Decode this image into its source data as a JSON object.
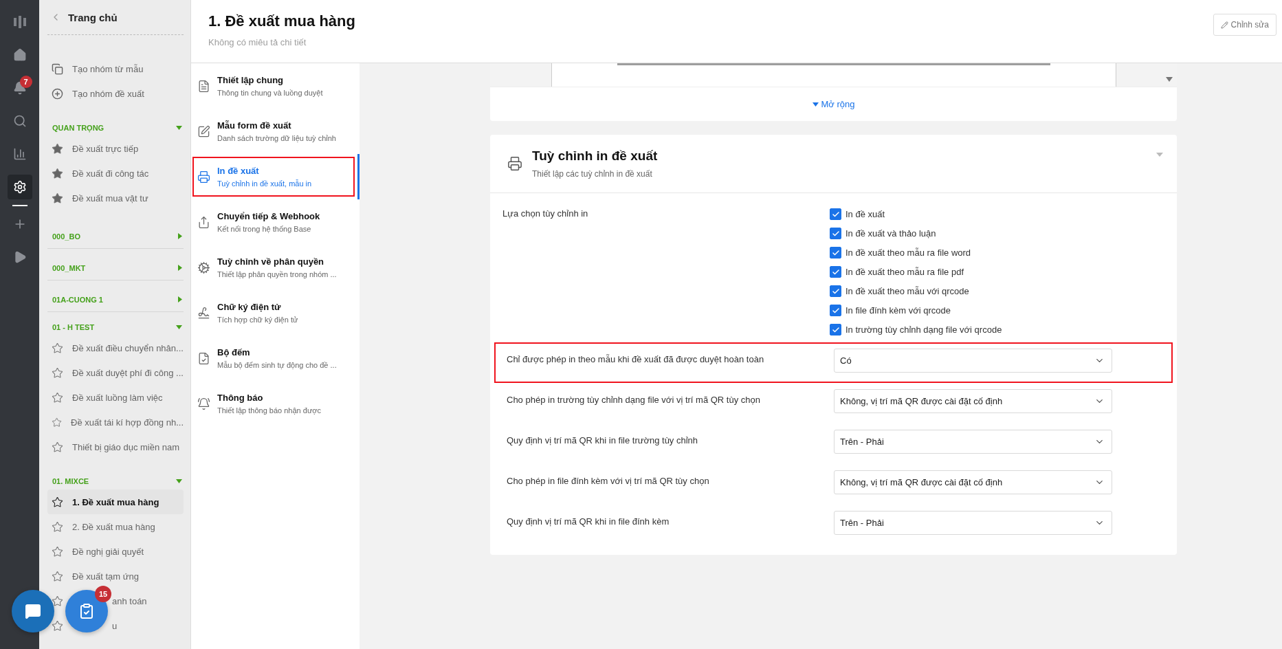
{
  "rail": [
    {
      "kind": "logo",
      "selected": false
    },
    {
      "kind": "home",
      "selected": false
    },
    {
      "kind": "bell",
      "selected": false,
      "badge": "7"
    },
    {
      "kind": "search",
      "selected": false
    },
    {
      "kind": "chart",
      "selected": false
    },
    {
      "kind": "settings",
      "selected": true
    },
    {
      "kind": "add",
      "selected": false
    },
    {
      "kind": "play",
      "selected": false
    }
  ],
  "sidebar": {
    "back_label": "Trang chủ",
    "actions": [
      {
        "kind": "template",
        "label": "Tạo nhóm từ mẫu"
      },
      {
        "kind": "add",
        "label": "Tạo nhóm đề xuất"
      }
    ],
    "groups": [
      {
        "name": "QUAN TRỌNG",
        "expanded": true,
        "items": [
          {
            "kind": "normal",
            "label": "Đề xuất trực tiếp",
            "starred": true,
            "selected": false
          },
          {
            "kind": "normal",
            "label": "Đề xuất đi công tác",
            "starred": true,
            "selected": false
          },
          {
            "kind": "normal",
            "label": "Đề xuất mua vật tư",
            "starred": true,
            "selected": false
          }
        ]
      },
      {
        "name": "000_BO",
        "expanded": false
      },
      {
        "name": "000_MKT",
        "expanded": false
      },
      {
        "name": "01A-CUONG 1",
        "expanded": false
      },
      {
        "name": "01 - H TEST",
        "expanded": true,
        "items": [
          {
            "kind": "normal",
            "label": "Đề xuất điều chuyển nhân...",
            "starred": false,
            "selected": false
          },
          {
            "kind": "normal",
            "label": "Đề xuất duyệt phí đi công ...",
            "starred": false,
            "selected": false
          },
          {
            "kind": "normal",
            "label": "Đề xuất luồng làm việc",
            "starred": false,
            "selected": false
          },
          {
            "kind": "normal",
            "label": "Đề xuất tái kí hợp đồng nh...",
            "starred": false,
            "selected": false
          },
          {
            "kind": "normal",
            "label": "Thiết bị giáo dục miền nam",
            "starred": false,
            "selected": false
          }
        ]
      },
      {
        "name": "01. MIXCE",
        "expanded": true,
        "items": [
          {
            "kind": "normal",
            "label": "1. Đề xuất mua hàng",
            "starred": false,
            "selected": true
          },
          {
            "kind": "normal",
            "label": "2. Đề xuất mua hàng",
            "starred": false,
            "selected": false
          },
          {
            "kind": "normal",
            "label": "Đề nghị giải quyết",
            "starred": false,
            "selected": false
          },
          {
            "kind": "normal",
            "label": "Đề xuất tạm ứng",
            "starred": false,
            "selected": false
          },
          {
            "kind": "covered",
            "label": "anh toán",
            "starred": false,
            "selected": false
          },
          {
            "kind": "covered",
            "label": "u",
            "starred": false,
            "selected": false
          }
        ]
      }
    ]
  },
  "floating": {
    "task_badge": "15"
  },
  "header": {
    "title": "1. Đề xuất mua hàng",
    "subtitle": "Không có miêu tả chi tiết",
    "edit_button": "Chỉnh sửa"
  },
  "nav": [
    {
      "kind": "general",
      "title": "Thiết lập chung",
      "subtitle": "Thông tin chung và luồng duyệt",
      "selected": false,
      "highlighted": false
    },
    {
      "kind": "form",
      "title": "Mẫu form đề xuất",
      "subtitle": "Danh sách trường dữ liệu tuỳ chỉnh",
      "selected": false,
      "highlighted": false
    },
    {
      "kind": "print",
      "title": "In đề xuất",
      "subtitle": "Tuỳ chỉnh in đề xuất, mẫu in",
      "selected": true,
      "highlighted": true
    },
    {
      "kind": "forward",
      "title": "Chuyển tiếp & Webhook",
      "subtitle": "Kết nối trong hệ thống Base",
      "selected": false,
      "highlighted": false
    },
    {
      "kind": "permission",
      "title": "Tuỳ chỉnh về phân quyền",
      "subtitle": "Thiết lập phân quyền trong nhóm ...",
      "selected": false,
      "highlighted": false
    },
    {
      "kind": "signature",
      "title": "Chữ ký điện tử",
      "subtitle": "Tích hợp chữ ký điện tử",
      "selected": false,
      "highlighted": false
    },
    {
      "kind": "counter",
      "title": "Bộ đếm",
      "subtitle": "Mẫu bộ đếm sinh tự động cho đề ...",
      "selected": false,
      "highlighted": false
    },
    {
      "kind": "notification",
      "title": "Thông báo",
      "subtitle": "Thiết lập thông báo nhận được",
      "selected": false,
      "highlighted": false
    }
  ],
  "preview_card": {
    "expand_link": "Mở rộng"
  },
  "print_card": {
    "title": "Tuỳ chỉnh in đề xuất",
    "subtitle": "Thiết lập các tuỳ chỉnh in đề xuất",
    "options_label": "Lựa chọn tùy chỉnh in",
    "options": [
      {
        "label": "In đề xuất",
        "checked": true
      },
      {
        "label": "In đề xuất và thảo luận",
        "checked": true
      },
      {
        "label": "In đề xuất theo mẫu ra file word",
        "checked": true
      },
      {
        "label": "In đề xuất theo mẫu ra file pdf",
        "checked": true
      },
      {
        "label": "In đề xuất theo mẫu với qrcode",
        "checked": true
      },
      {
        "label": "In file đính kèm với qrcode",
        "checked": true
      },
      {
        "label": "In trường tùy chỉnh dạng file với qrcode",
        "checked": true
      }
    ],
    "settings": [
      {
        "label": "Chỉ được phép in theo mẫu khi đề xuất đã được duyệt hoàn toàn",
        "value": "Có",
        "highlighted": true
      },
      {
        "label": "Cho phép in trường tùy chỉnh dạng file với vị trí mã QR tùy chọn",
        "value": "Không, vị trí mã QR được cài đặt cố định",
        "highlighted": false
      },
      {
        "label": "Quy định vị trí mã QR khi in file trường tùy chỉnh",
        "value": "Trên - Phải",
        "highlighted": false
      },
      {
        "label": "Cho phép in file đính kèm với vị trí mã QR tùy chọn",
        "value": "Không, vị trí mã QR được cài đặt cố định",
        "highlighted": false
      },
      {
        "label": "Quy định vị trí mã QR khi in file đính kèm",
        "value": "Trên - Phải",
        "highlighted": false
      }
    ]
  }
}
